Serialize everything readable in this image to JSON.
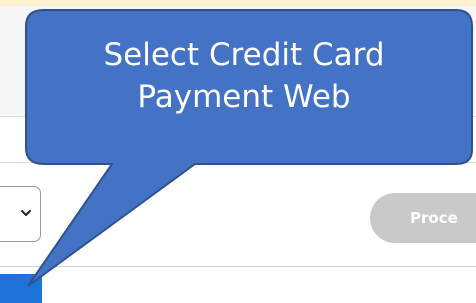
{
  "callout": {
    "line1": "Select Credit Card",
    "line2": "Payment Web"
  },
  "proceed_button": {
    "label": "Proce"
  },
  "payment_select": {
    "chevron_icon": "chevron-down-icon"
  },
  "colors": {
    "callout_fill": "#4472c4",
    "callout_border": "#2f528f",
    "button_fill": "#c9c9c9",
    "selection_highlight": "#1f73d8"
  }
}
